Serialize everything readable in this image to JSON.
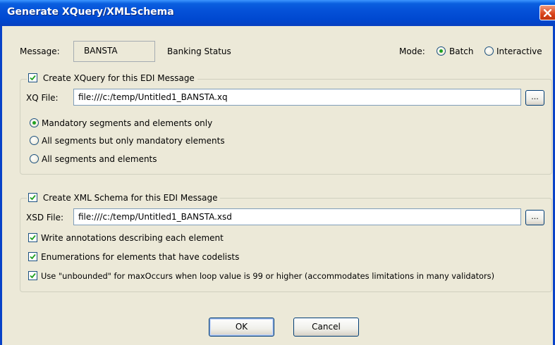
{
  "window": {
    "title": "Generate XQuery/XMLSchema"
  },
  "message": {
    "label": "Message:",
    "code": "BANSTA",
    "description": "Banking Status"
  },
  "mode": {
    "label": "Mode:",
    "options": [
      "Batch",
      "Interactive"
    ],
    "selected": "Batch"
  },
  "xquery": {
    "checkbox_label": "Create XQuery for this EDI Message",
    "checked": true,
    "file_label": "XQ File:",
    "file_value": "file:///c:/temp/Untitled1_BANSTA.xq",
    "browse_label": "...",
    "options": [
      "Mandatory segments and elements only",
      "All segments but only mandatory elements",
      "All segments and elements"
    ],
    "selected_option": "Mandatory segments and elements only"
  },
  "xmlschema": {
    "checkbox_label": "Create XML Schema for this EDI Message",
    "checked": true,
    "file_label": "XSD File:",
    "file_value": "file:///c:/temp/Untitled1_BANSTA.xsd",
    "browse_label": "...",
    "options": [
      {
        "label": "Write annotations describing each element",
        "checked": true
      },
      {
        "label": "Enumerations for elements that have codelists",
        "checked": true
      },
      {
        "label": "Use \"unbounded\" for maxOccurs when loop value is 99 or higher (accommodates limitations in many validators)",
        "checked": true
      }
    ]
  },
  "buttons": {
    "ok": "OK",
    "cancel": "Cancel"
  },
  "colors": {
    "titlebar": "#0551d8",
    "dialog_bg": "#ece9d8",
    "close_button": "#d9431b",
    "radio_dot": "#21a121",
    "checkmark": "#21a121"
  }
}
